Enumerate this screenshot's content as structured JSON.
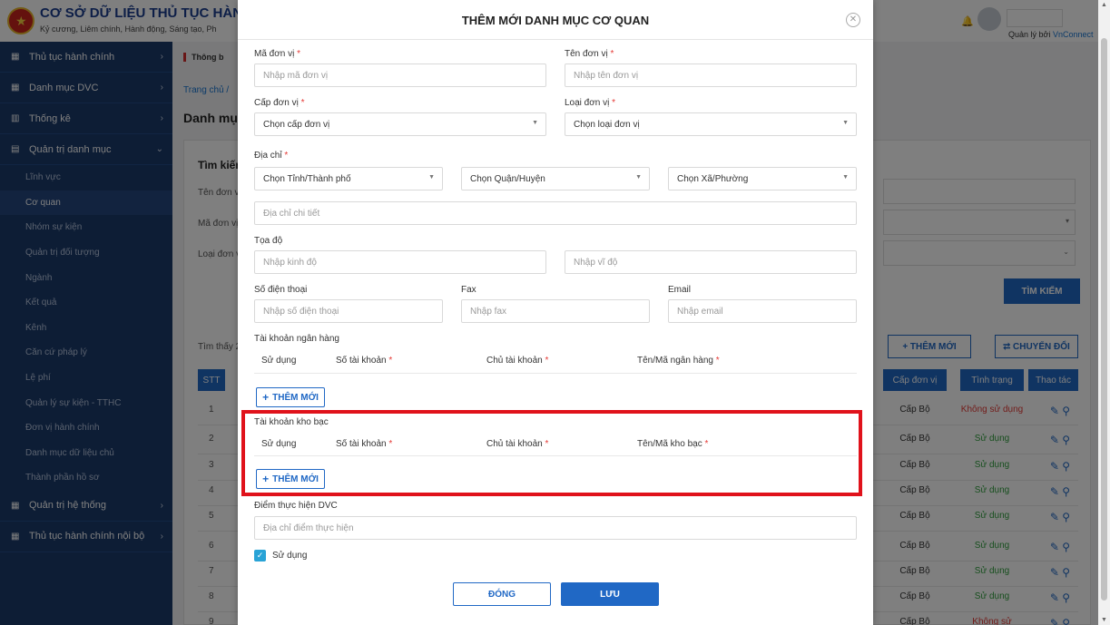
{
  "app": {
    "title": "CƠ SỞ DỮ LIỆU THỦ TỤC HÀNH",
    "subtitle": "Kỷ cương, Liêm chính, Hành động, Sáng tạo, Ph",
    "managed_prefix": "Quản lý bởi ",
    "managed_brand": "VnConnect"
  },
  "sidebar": {
    "menu1": "Thủ tục hành chính",
    "menu2": "Danh mục DVC",
    "menu3": "Thống kê",
    "menu4": "Quản trị danh mục",
    "subs": [
      "Lĩnh vực",
      "Cơ quan",
      "Nhóm sự kiện",
      "Quản trị đối tượng",
      "Ngành",
      "Kết quả",
      "Kênh",
      "Căn cứ pháp lý",
      "Lệ phí",
      "Quản lý sự kiện - TTHC",
      "Đơn vị hành chính",
      "Danh mục dữ liệu chủ",
      "Thành phần hồ sơ"
    ],
    "menu5": "Quản trị hệ thống",
    "menu6": "Thủ tục hành chính nội bộ"
  },
  "background": {
    "notice": "Thông b",
    "breadcrumb": "Trang chủ  /",
    "heading": "Danh mụ",
    "search_title": "Tìm kiếm",
    "field1": "Tên đơn v",
    "field2": "Mã đơn vị",
    "field3": "Loại đơn v",
    "search_btn": "TÌM KIẾM",
    "found": "Tìm thấy 2",
    "add_btn": "+ THÊM MỚI",
    "convert_btn": "⮂ CHUYỂN ĐỔI",
    "col_stt": "STT",
    "col_level": "Cấp đơn vị",
    "col_status": "Tình trạng",
    "col_action": "Thao tác",
    "rows": [
      {
        "stt": "1",
        "level": "Cấp Bộ",
        "status": "Không sử dụng",
        "active": false
      },
      {
        "stt": "2",
        "level": "Cấp Bộ",
        "status": "Sử dụng",
        "active": true
      },
      {
        "stt": "3",
        "level": "Cấp Bộ",
        "status": "Sử dụng",
        "active": true
      },
      {
        "stt": "4",
        "level": "Cấp Bộ",
        "status": "Sử dụng",
        "active": true
      },
      {
        "stt": "5",
        "level": "Cấp Bộ",
        "status": "Sử dụng",
        "active": true
      },
      {
        "stt": "6",
        "level": "Cấp Bộ",
        "status": "Sử dụng",
        "active": true
      },
      {
        "stt": "7",
        "level": "Cấp Bộ",
        "status": "Sử dụng",
        "active": true
      },
      {
        "stt": "8",
        "level": "Cấp Bộ",
        "status": "Sử dụng",
        "active": true
      },
      {
        "stt": "9",
        "level": "Cấp Bộ",
        "status": "Không sử",
        "active": false
      }
    ]
  },
  "modal": {
    "title": "THÊM MỚI DANH MỤC CƠ QUAN",
    "code_label": "Mã đơn vị",
    "code_ph": "Nhập mã đơn vị",
    "name_label": "Tên đơn vị",
    "name_ph": "Nhập tên đơn vị",
    "level_label": "Cấp đơn vị",
    "level_value": "Chọn cấp đơn vị",
    "type_label": "Loại đơn vị",
    "type_value": "Chọn loại đơn vị",
    "address_label": "Địa chỉ",
    "province_value": "Chọn Tỉnh/Thành phố",
    "district_value": "Chọn Quận/Huyện",
    "ward_value": "Chọn Xã/Phường",
    "address_detail_ph": "Địa chỉ chi tiết",
    "coord_label": "Tọa độ",
    "lng_ph": "Nhập kinh độ",
    "lat_ph": "Nhập vĩ độ",
    "phone_label": "Số điện thoại",
    "phone_ph": "Nhập số điện thoại",
    "fax_label": "Fax",
    "fax_ph": "Nhập fax",
    "email_label": "Email",
    "email_ph": "Nhập email",
    "bank_section": "Tài khoản ngân hàng",
    "bank_cols": [
      "Sử dụng",
      "Số tài khoản",
      "Chủ tài khoản",
      "Tên/Mã ngân hàng"
    ],
    "treasury_section": "Tài khoản kho bạc",
    "treasury_cols": [
      "Sử dụng",
      "Số tài khoản",
      "Chủ tài khoản",
      "Tên/Mã kho bạc"
    ],
    "add_label": "THÊM MỚI",
    "dvc_label": "Điểm thực hiện DVC",
    "dvc_ph": "Địa chỉ điểm thực hiện",
    "use_label": "Sử dụng",
    "close_btn": "ĐÓNG",
    "save_btn": "LƯU"
  }
}
